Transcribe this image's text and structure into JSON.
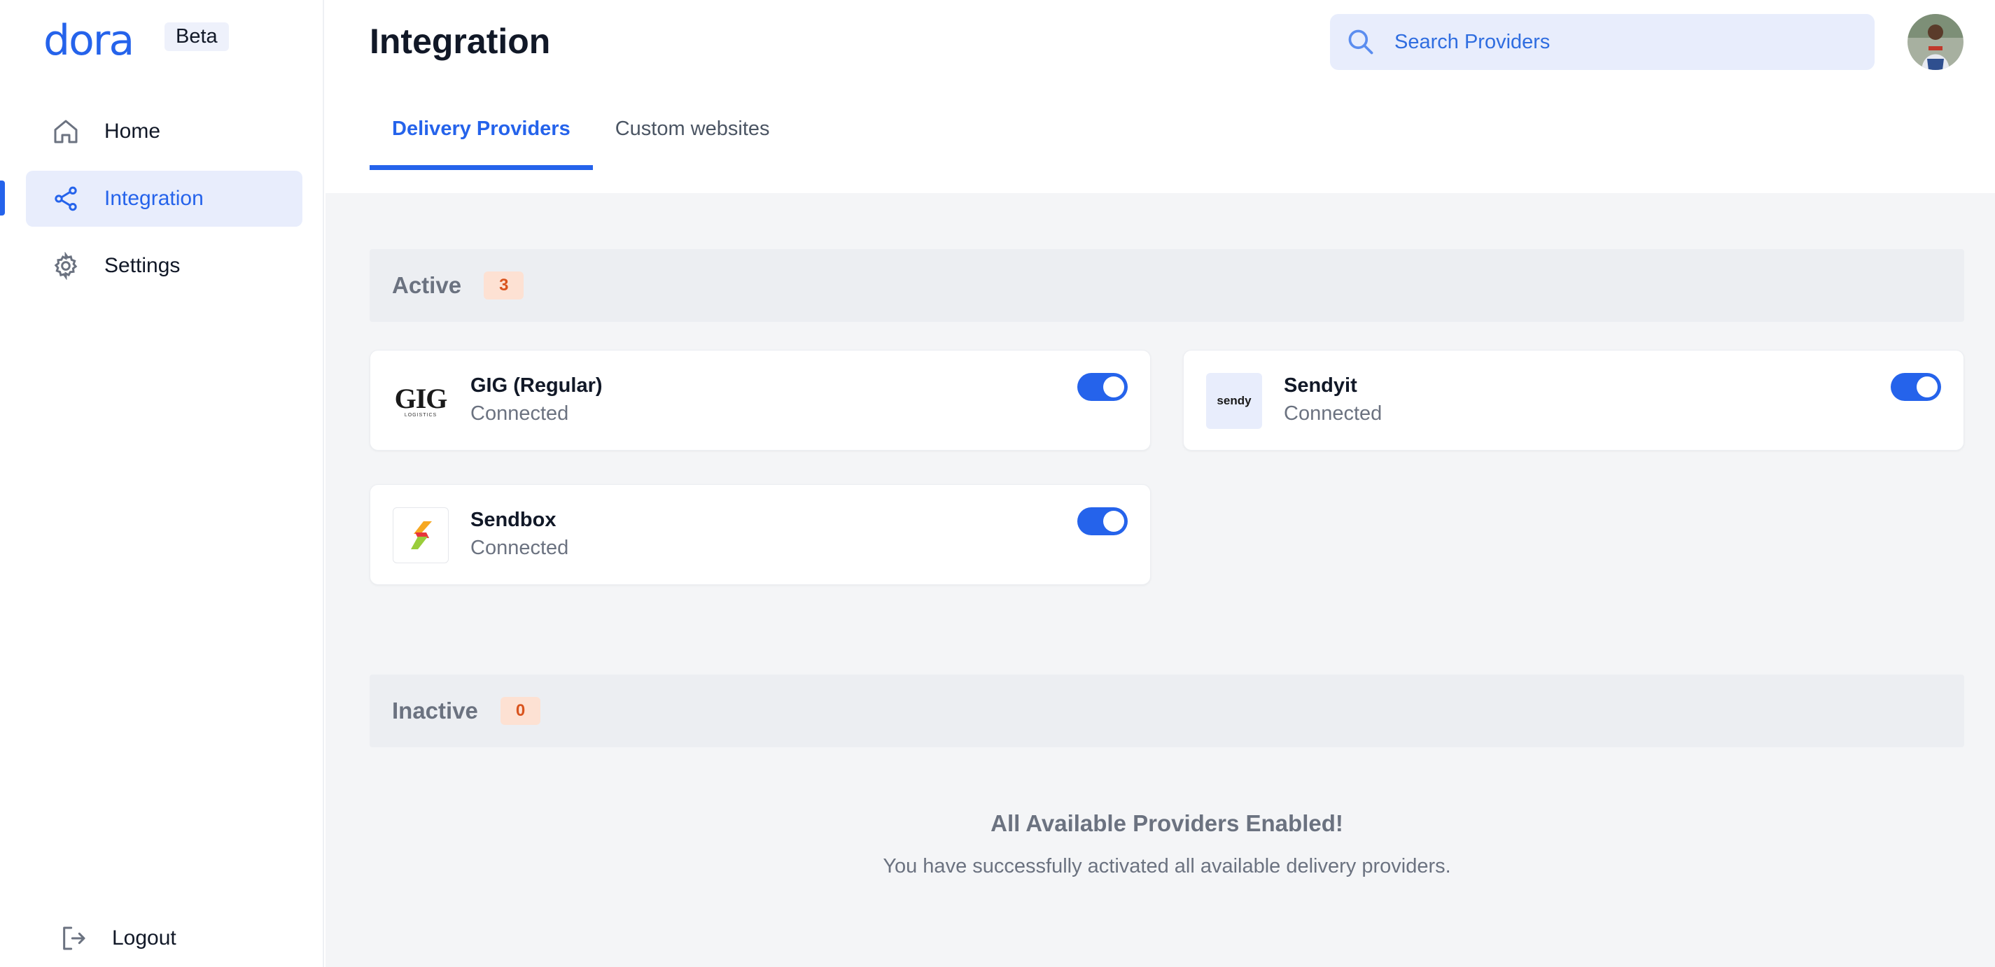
{
  "brand": {
    "logo_text": "dora",
    "badge": "Beta"
  },
  "sidebar": {
    "items": [
      {
        "label": "Home",
        "icon": "home-icon"
      },
      {
        "label": "Integration",
        "icon": "share-icon",
        "active": true
      },
      {
        "label": "Settings",
        "icon": "gear-icon"
      }
    ],
    "logout": {
      "label": "Logout",
      "icon": "logout-icon"
    }
  },
  "header": {
    "title": "Integration",
    "search": {
      "placeholder": "Search Providers",
      "value": ""
    },
    "avatar": "user-avatar"
  },
  "tabs": [
    {
      "label": "Delivery Providers",
      "active": true
    },
    {
      "label": "Custom websites",
      "active": false
    }
  ],
  "active_section": {
    "title": "Active",
    "count": "3",
    "providers": [
      {
        "name": "GIG (Regular)",
        "status": "Connected",
        "enabled": true,
        "logo_text": "GIG",
        "logo_subtext": "LOGISTICS"
      },
      {
        "name": "Sendyit",
        "status": "Connected",
        "enabled": true,
        "logo_text": "sendy"
      },
      {
        "name": "Sendbox",
        "status": "Connected",
        "enabled": true,
        "logo_text": ""
      }
    ]
  },
  "inactive_section": {
    "title": "Inactive",
    "count": "0",
    "empty_title": "All Available Providers Enabled!",
    "empty_desc": "You have successfully activated all available delivery providers."
  },
  "colors": {
    "accent": "#2563eb",
    "badge_bg": "#fde1d3",
    "badge_text": "#d9541e",
    "content_bg": "#f4f5f7"
  }
}
